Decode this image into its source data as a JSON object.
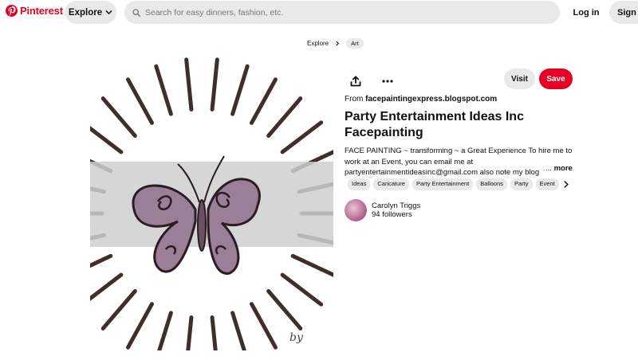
{
  "header": {
    "logo_text": "Pinterest",
    "explore_label": "Explore",
    "search_placeholder": "Search for easy dinners, fashion, etc.",
    "login_label": "Log in",
    "signup_label": "Sign up"
  },
  "breadcrumb": {
    "items": [
      "Explore",
      "Art"
    ]
  },
  "pin": {
    "image_alt_icon": "butterfly-image",
    "visit_label": "Visit",
    "save_label": "Save",
    "source_prefix": "From ",
    "source_domain": "facepaintingexpress.blogspot.com",
    "title": "Party Entertainment Ideas Inc Facepainting",
    "description": "FACE PAINTING ~ transforming ~ a Great Experience To hire me to work at an Event, you can email me at partyentertainmentideasinc@gmail.com also note my blog",
    "more_ellipsis": "...",
    "more_label": "more",
    "tags": [
      "Ideas",
      "Caricature",
      "Party Entertainment",
      "Balloons",
      "Party",
      "Event"
    ],
    "author": {
      "name": "Carolyn Triggs",
      "followers": "94 followers"
    }
  },
  "colors": {
    "brand": "#e60023",
    "chip_bg": "#e9e9e9",
    "text": "#111111"
  },
  "icons": {
    "logo": "pinterest-logo-icon",
    "explore_chevron": "chevron-down-icon",
    "search": "search-icon",
    "share": "share-icon",
    "more": "more-options-icon",
    "tags_next": "chevron-right-icon"
  }
}
